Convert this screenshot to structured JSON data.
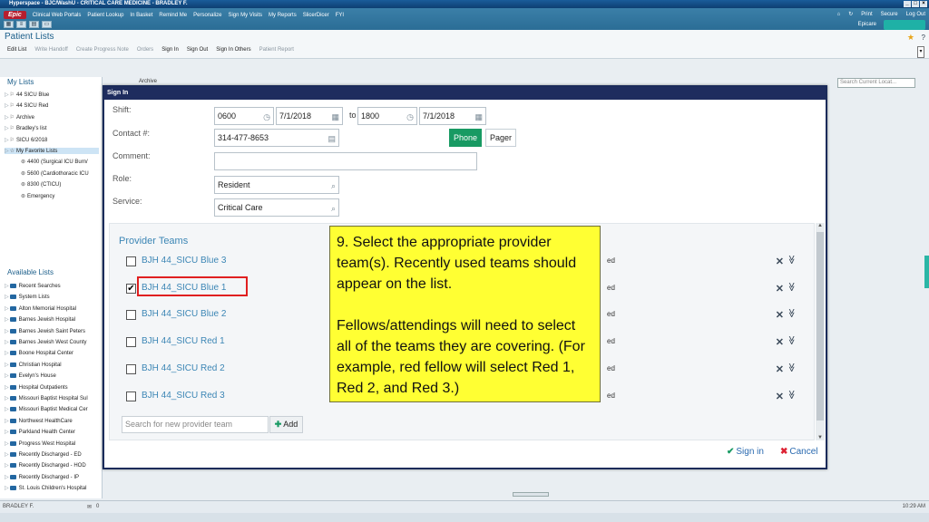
{
  "window": {
    "title": "Hyperspace - BJC/WashU - CRITICAL CARE MEDICINE - BRADLEY F.",
    "controls": [
      "_",
      "□",
      "×"
    ]
  },
  "menubar": {
    "epic_label": "Epic",
    "items": [
      "Clinical Web Portals",
      "Patient Lookup",
      "In Basket",
      "Remind Me",
      "Personalize",
      "Sign My Visits",
      "My Reports",
      "SlicerDicer",
      "FYI"
    ],
    "right_items": [
      "Print",
      "Secure",
      "Log Out"
    ],
    "epicare": "Epicare"
  },
  "header": {
    "page_title": "Patient Lists",
    "toolbar": [
      "Edit List",
      "Write Handoff",
      "Create Progress Note",
      "Orders",
      "Sign In",
      "Sign Out",
      "Sign In Others",
      "Patient Report"
    ]
  },
  "left_pane": {
    "my_lists_header": "My Lists",
    "my_lists": [
      {
        "label": "44 SICU Blue",
        "indent": 0
      },
      {
        "label": "44 SICU Red",
        "indent": 0
      },
      {
        "label": "Archive",
        "indent": 0
      },
      {
        "label": "Bradley's list",
        "indent": 0
      },
      {
        "label": "SICU 6/2018",
        "indent": 0
      },
      {
        "label": "My Favorite Lists",
        "indent": 0
      },
      {
        "label": "4400 (Surgical ICU Burn/",
        "indent": 1
      },
      {
        "label": "5600 (Cardiothoracic ICU",
        "indent": 1
      },
      {
        "label": "8300 (CTICU)",
        "indent": 1
      },
      {
        "label": "Emergency",
        "indent": 1
      }
    ],
    "available_header": "Available Lists",
    "available_lists": [
      "Recent Searches",
      "System Lists",
      "Alton Memorial Hospital",
      "Barnes Jewish Hospital",
      "Barnes Jewish Saint Peters",
      "Barnes Jewish West County",
      "Boone Hospital Center",
      "Christian Hospital",
      "Evelyn's House",
      "Hospital Outpatients",
      "Missouri Baptist Hospital Sul",
      "Missouri Baptist Medical Cer",
      "Northwest HealthCare",
      "Parkland Health Center",
      "Progress West Hospital",
      "Recently Discharged - ED",
      "Recently Discharged - HOD",
      "Recently Discharged - IP",
      "St. Louis Children's Hospital"
    ]
  },
  "background": {
    "archive_label": "Archive",
    "search_placeholder": "Search Current Locat..."
  },
  "dialog": {
    "title": "Sign In",
    "shift_label": "Shift:",
    "shift_start_time": "0600",
    "shift_start_date": "7/1/2018",
    "to_label": "to",
    "shift_end_time": "1800",
    "shift_end_date": "7/1/2018",
    "contact_label": "Contact #:",
    "contact_value": "314-477-8653",
    "phone_label": "Phone",
    "pager_label": "Pager",
    "comment_label": "Comment:",
    "comment_value": "",
    "role_label": "Role:",
    "role_value": "Resident",
    "service_label": "Service:",
    "service_value": "Critical Care",
    "teams_header": "Provider Teams",
    "teams": [
      {
        "name": "BJH 44_SICU Blue 3",
        "checked": false,
        "suffix": "ed"
      },
      {
        "name": "BJH 44_SICU Blue 1",
        "checked": true,
        "suffix": "ed"
      },
      {
        "name": "BJH 44_SICU Blue 2",
        "checked": false,
        "suffix": "ed"
      },
      {
        "name": "BJH 44_SICU Red 1",
        "checked": false,
        "suffix": "ed"
      },
      {
        "name": "BJH 44_SICU Red 2",
        "checked": false,
        "suffix": "ed"
      },
      {
        "name": "BJH 44_SICU Red 3",
        "checked": false,
        "suffix": "ed"
      }
    ],
    "team_search_placeholder": "Search for new provider team",
    "add_label": "Add",
    "sign_in_label": "Sign in",
    "cancel_label": "Cancel"
  },
  "callout": {
    "text": "9. Select the appropriate provider team(s).  Recently used teams should appear on the list.\n\nFellows/attendings will need to select all of the teams they are covering.  (For example, red fellow will select Red 1, Red 2, and Red 3.)"
  },
  "statusbar": {
    "user": "BRADLEY F.",
    "mail_count": "0",
    "time": "10:29 AM"
  },
  "colors": {
    "accent": "#1b5e8a",
    "phone_active": "#189a63",
    "highlight_border": "#e02020",
    "callout_bg": "#ffff33",
    "dialog_title": "#1e2c5e"
  }
}
